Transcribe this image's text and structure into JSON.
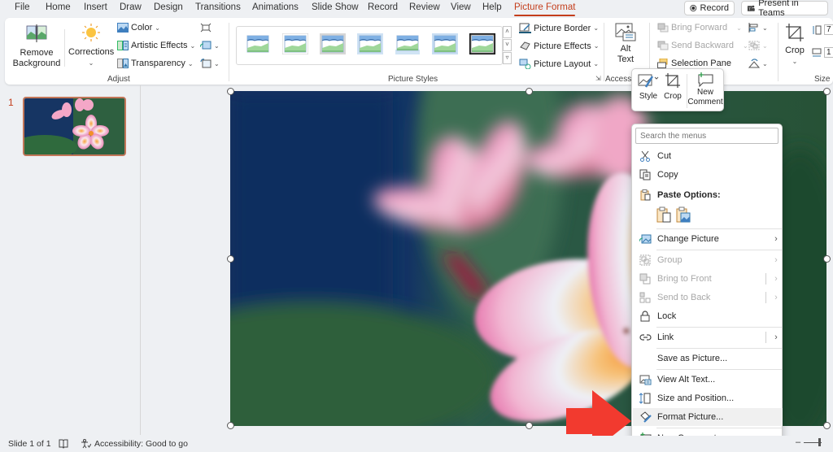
{
  "tabs": [
    {
      "label": "File"
    },
    {
      "label": "Home"
    },
    {
      "label": "Insert"
    },
    {
      "label": "Draw"
    },
    {
      "label": "Design"
    },
    {
      "label": "Transitions"
    },
    {
      "label": "Animations"
    },
    {
      "label": "Slide Show"
    },
    {
      "label": "Record"
    },
    {
      "label": "Review"
    },
    {
      "label": "View"
    },
    {
      "label": "Help"
    },
    {
      "label": "Picture Format",
      "active": true
    }
  ],
  "top_buttons": {
    "record": "Record",
    "present_in_teams": "Present in Teams"
  },
  "ribbon": {
    "adjust": {
      "label": "Adjust",
      "remove_background_line1": "Remove",
      "remove_background_line2": "Background",
      "corrections": "Corrections",
      "color": "Color",
      "artistic_effects": "Artistic Effects",
      "transparency": "Transparency"
    },
    "picture_styles": {
      "label": "Picture Styles",
      "gallery_count": 7,
      "picture_border": "Picture Border",
      "picture_effects": "Picture Effects",
      "picture_layout": "Picture Layout"
    },
    "accessibility": {
      "label": "Accessi",
      "alt_text_line1": "Alt",
      "alt_text_line2": "Text"
    },
    "arrange": {
      "bring_forward": "Bring Forward",
      "send_backward": "Send Backward",
      "selection_pane": "Selection Pane"
    },
    "size": {
      "label": "Size",
      "crop": "Crop",
      "height_partial": "7",
      "width_partial": "1"
    }
  },
  "slides_pane": {
    "slide_number": "1"
  },
  "mini_toolbar": {
    "style": "Style",
    "crop": "Crop",
    "new_comment_line1": "New",
    "new_comment_line2": "Comment"
  },
  "context_menu": {
    "search_placeholder": "Search the menus",
    "items": {
      "cut": "Cut",
      "copy": "Copy",
      "paste_options": "Paste Options:",
      "change_picture": "Change Picture",
      "group": "Group",
      "bring_to_front": "Bring to Front",
      "send_to_back": "Send to Back",
      "lock": "Lock",
      "link": "Link",
      "save_as_picture": "Save as Picture...",
      "view_alt_text": "View Alt Text...",
      "size_and_position": "Size and Position...",
      "format_picture": "Format Picture...",
      "new_comment": "New Comment"
    }
  },
  "statusbar": {
    "slide_indicator": "Slide 1 of 1",
    "accessibility": "Accessibility: Good to go"
  },
  "colors": {
    "accent": "#c43e1c",
    "annotation_arrow": "#f23a2f"
  }
}
